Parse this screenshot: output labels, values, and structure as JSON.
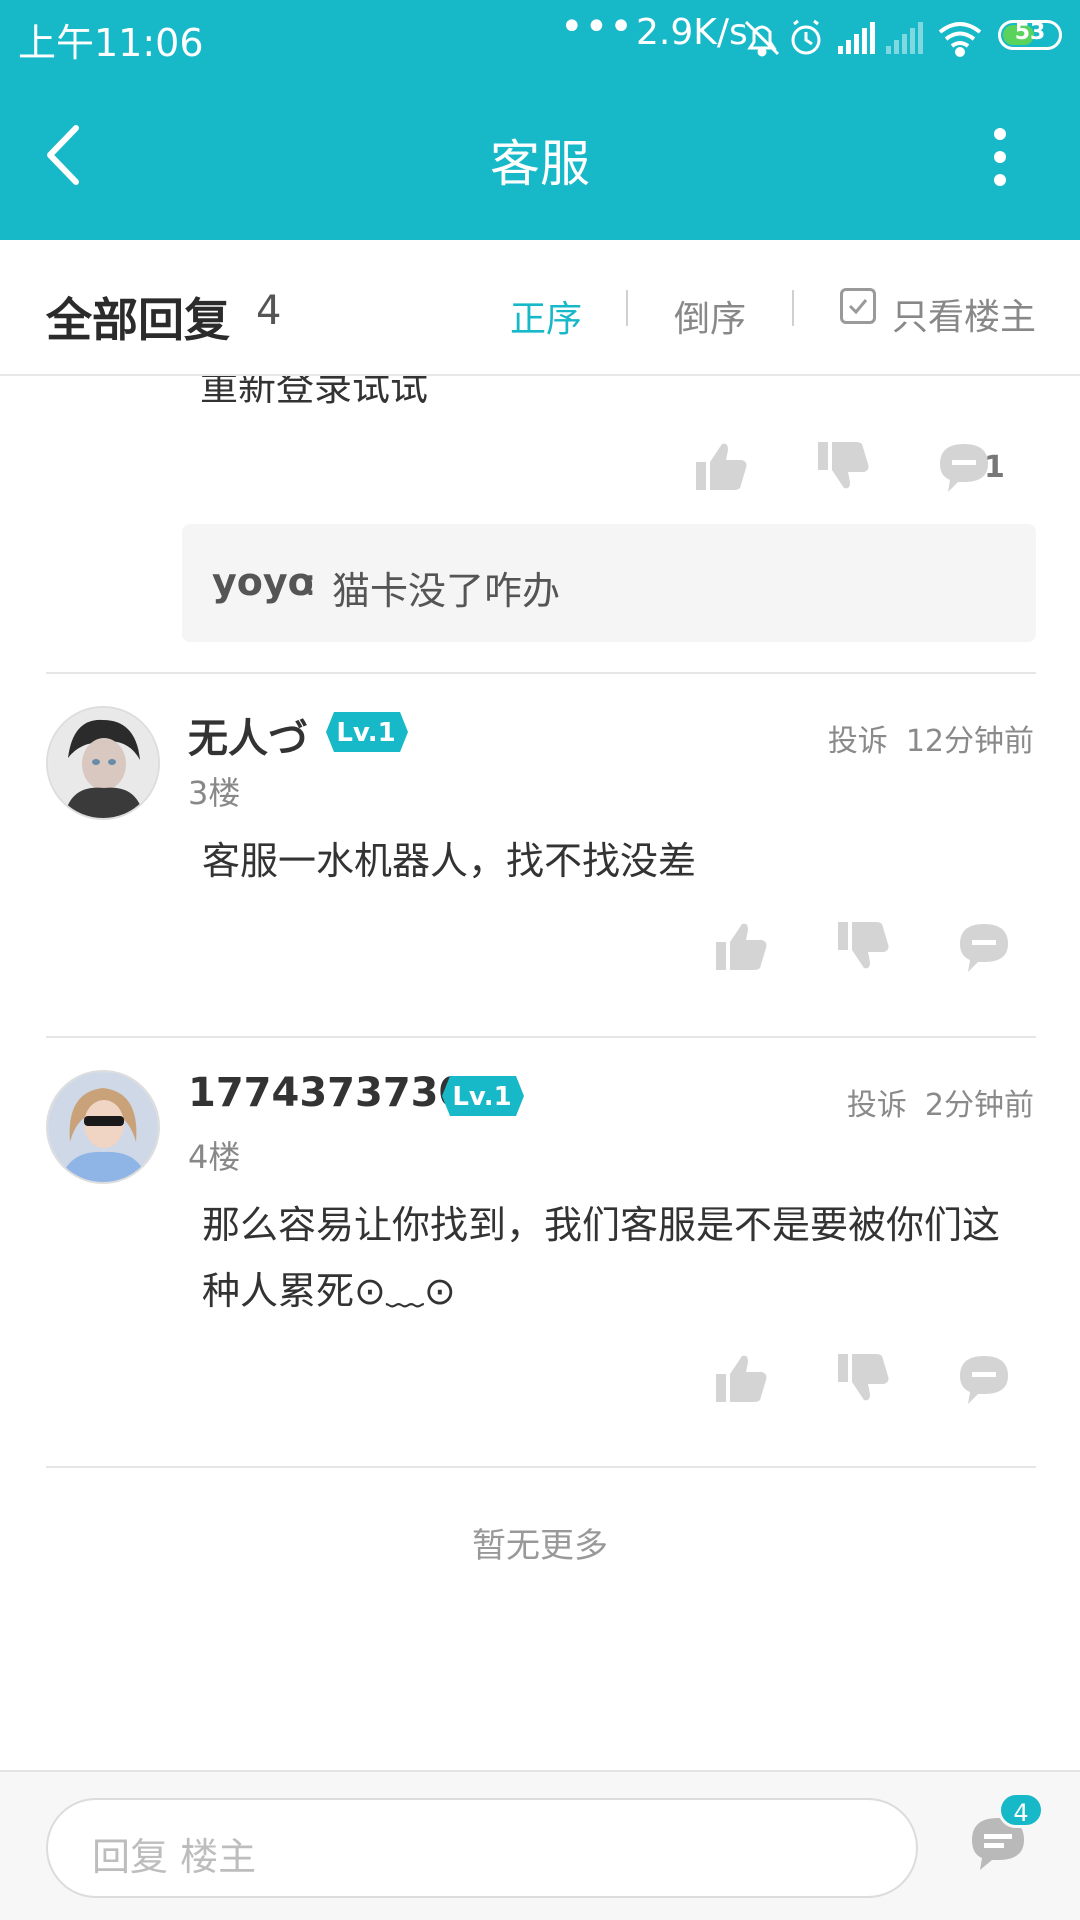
{
  "status_bar": {
    "time": "上午11:06",
    "dots": "•••",
    "speed": "2.9K/s",
    "battery": "53"
  },
  "nav": {
    "title": "客服"
  },
  "filter": {
    "title": "全部回复",
    "count": "4",
    "ascending": "正序",
    "descending": "倒序",
    "only_op": "只看楼主"
  },
  "previous_post": {
    "partial_text": "重新登录试试",
    "comment_count": "1",
    "sub_reply": {
      "user": "yoyo",
      "separator": ":",
      "text": "猫卡没了咋办"
    }
  },
  "posts": [
    {
      "username": "无人づ",
      "level": "Lv.1",
      "floor": "3楼",
      "report": "投诉",
      "time": "12分钟前",
      "content": "客服一水机器人，找不找没差"
    },
    {
      "username": "1774373730",
      "level": "Lv.1",
      "floor": "4楼",
      "report": "投诉",
      "time": "2分钟前",
      "content": "那么容易让你找到，我们客服是不是要被你们这种人累死⊙﹏⊙"
    }
  ],
  "no_more": "暂无更多",
  "bottom": {
    "reply_placeholder": "回复  楼主",
    "comment_badge": "4"
  },
  "colors": {
    "accent": "#17b9c8",
    "level_badge": "#17b9c8"
  }
}
